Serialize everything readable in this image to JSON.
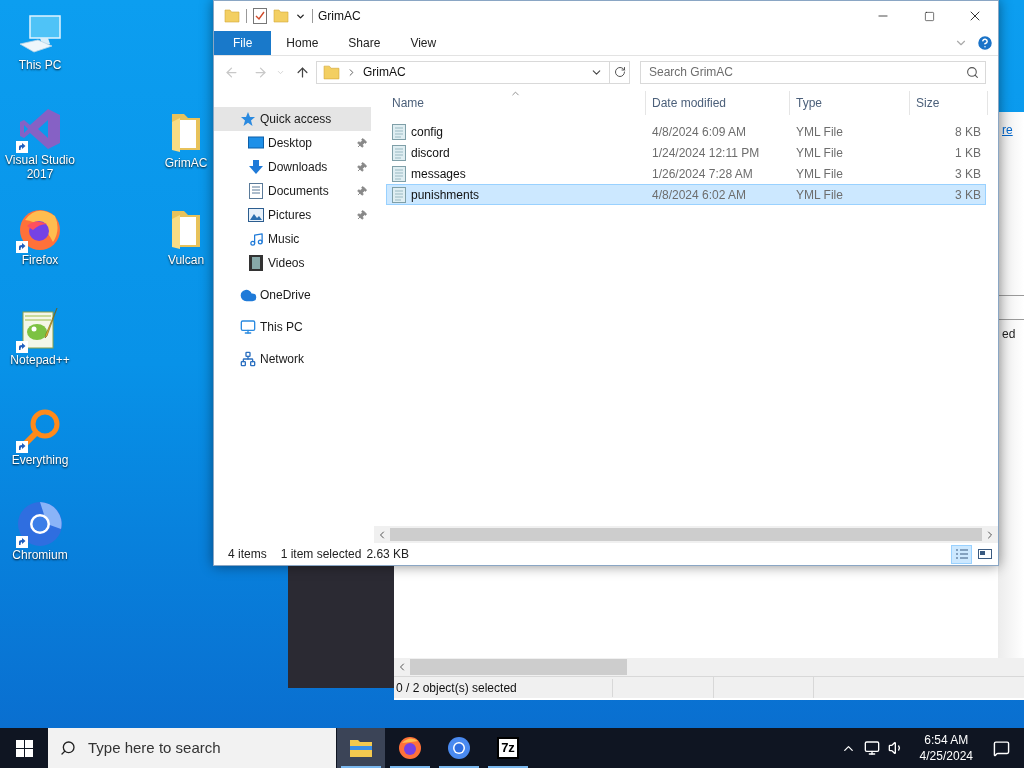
{
  "desktop": {
    "icons": [
      {
        "label": "This PC",
        "kind": "pc",
        "shortcut": false
      },
      {
        "label": "Visual Studio 2017",
        "kind": "vs",
        "shortcut": true
      },
      {
        "label": "Firefox",
        "kind": "firefox",
        "shortcut": true
      },
      {
        "label": "Notepad++",
        "kind": "notepad",
        "shortcut": true
      },
      {
        "label": "Everything",
        "kind": "everything",
        "shortcut": true
      },
      {
        "label": "Chromium",
        "kind": "chromium",
        "shortcut": true
      },
      {
        "label": "GrimAC",
        "kind": "folder",
        "shortcut": false
      },
      {
        "label": "Vulcan",
        "kind": "folder",
        "shortcut": false
      }
    ]
  },
  "background_window": {
    "link_fragment": "re",
    "text_fragment": "ed",
    "status": "0 / 2 object(s) selected"
  },
  "explorer": {
    "title": "GrimAC",
    "ribbon_tabs": [
      {
        "label": "File",
        "kind": "file"
      },
      {
        "label": "Home",
        "kind": "tab"
      },
      {
        "label": "Share",
        "kind": "tab"
      },
      {
        "label": "View",
        "kind": "tab"
      }
    ],
    "address": {
      "path": "GrimAC"
    },
    "search": {
      "placeholder": "Search GrimAC"
    },
    "nav": [
      {
        "label": "Quick access",
        "kind": "star",
        "selected": true,
        "children": [
          {
            "label": "Desktop",
            "kind": "desktop",
            "pinned": true,
            "selected": false
          },
          {
            "label": "Downloads",
            "kind": "download",
            "pinned": true,
            "selected": false
          },
          {
            "label": "Documents",
            "kind": "document",
            "pinned": true,
            "selected": false
          },
          {
            "label": "Pictures",
            "kind": "pictures",
            "pinned": true,
            "selected": false
          },
          {
            "label": "Music",
            "kind": "music",
            "pinned": false,
            "selected": false
          },
          {
            "label": "Videos",
            "kind": "video",
            "pinned": false,
            "selected": false
          }
        ]
      },
      {
        "label": "OneDrive",
        "kind": "cloud",
        "selected": false
      },
      {
        "label": "This PC",
        "kind": "pc",
        "selected": false
      },
      {
        "label": "Network",
        "kind": "network",
        "selected": false
      }
    ],
    "columns": [
      "Name",
      "Date modified",
      "Type",
      "Size"
    ],
    "files": [
      {
        "name": "config",
        "date": "4/8/2024 6:09 AM",
        "type": "YML File",
        "size": "8 KB",
        "selected": false
      },
      {
        "name": "discord",
        "date": "1/24/2024 12:11 PM",
        "type": "YML File",
        "size": "1 KB",
        "selected": false
      },
      {
        "name": "messages",
        "date": "1/26/2024 7:28 AM",
        "type": "YML File",
        "size": "3 KB",
        "selected": false
      },
      {
        "name": "punishments",
        "date": "4/8/2024 6:02 AM",
        "type": "YML File",
        "size": "3 KB",
        "selected": true
      }
    ],
    "status": {
      "count": "4 items",
      "selection": "1 item selected",
      "size": "2.63 KB"
    },
    "views": [
      {
        "kind": "details",
        "selected": true
      },
      {
        "kind": "tiles",
        "selected": false
      }
    ]
  },
  "taskbar": {
    "search_placeholder": "Type here to search",
    "apps": [
      {
        "kind": "explorer",
        "active": true,
        "running": true
      },
      {
        "kind": "firefox",
        "active": false,
        "running": true
      },
      {
        "kind": "chromium",
        "active": false,
        "running": true
      },
      {
        "kind": "sevenzip",
        "label": "7z",
        "active": false,
        "running": true
      }
    ],
    "time": "6:54 AM",
    "date": "4/25/2024"
  }
}
